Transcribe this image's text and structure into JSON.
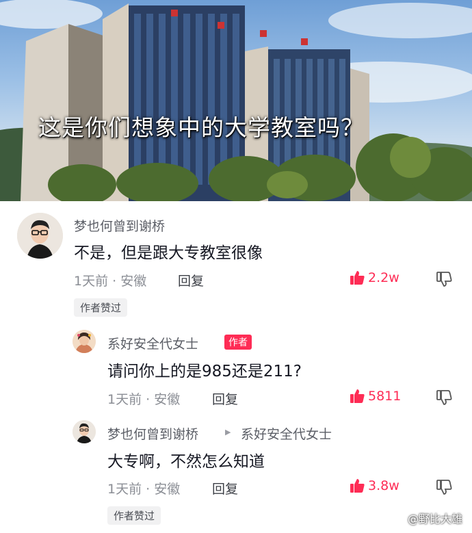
{
  "post": {
    "caption": "这是你们想象中的大学教室吗？"
  },
  "comments": [
    {
      "username": "梦也何曾到谢桥",
      "text": "不是，但是跟大专教室很像",
      "meta": "1天前 · 安徽",
      "reply_label": "回复",
      "likes": "2.2w",
      "author_liked": "作者赞过"
    },
    {
      "username": "系好安全代女士",
      "author_tag": "作者",
      "text": "请问你上的是985还是211?",
      "meta": "1天前 · 安徽",
      "reply_label": "回复",
      "likes": "5811"
    },
    {
      "username": "梦也何曾到谢桥",
      "reply_to": "系好安全代女士",
      "text": "大专啊，不然怎么知道",
      "meta": "1天前 · 安徽",
      "reply_label": "回复",
      "likes": "3.8w",
      "author_liked": "作者赞过"
    }
  ],
  "watermark": "@野比大雄",
  "icons": {
    "like": "thumbs-up-icon",
    "dislike": "thumbs-down-icon",
    "reply_arrow": "triangle-right-icon"
  },
  "colors": {
    "accent": "#fe2c55",
    "text": "#161823",
    "secondary": "#8a8d94"
  }
}
